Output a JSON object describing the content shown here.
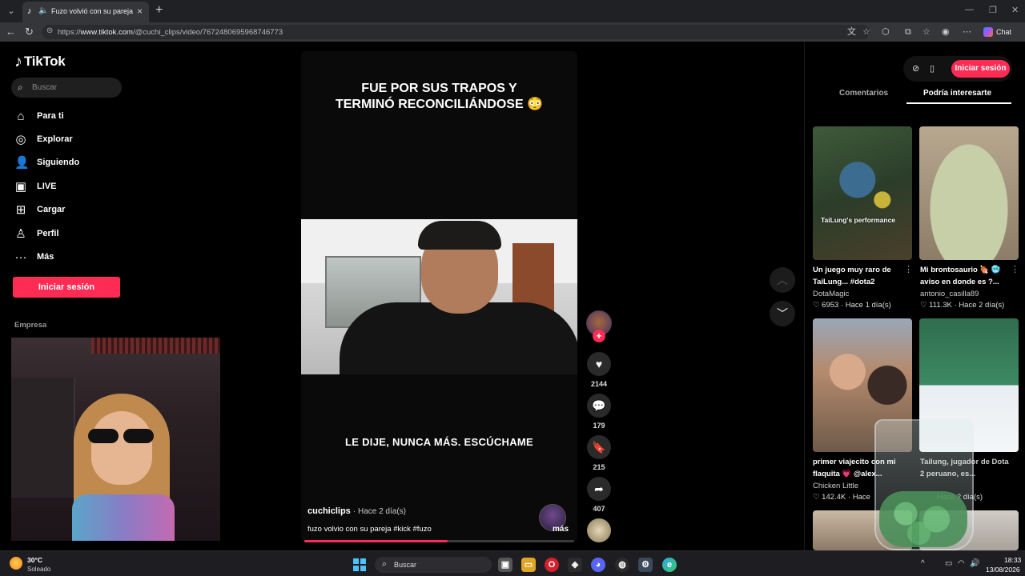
{
  "browser": {
    "tab_title": "Fuzo volvió con su pareja: qu",
    "url_prefix": "https://",
    "url_host": "www.tiktok.com",
    "url_path": "/@cuchi_clips/video/7672480695968746773",
    "chat_label": "Chat"
  },
  "sidebar": {
    "logo": "TikTok",
    "search_placeholder": "Buscar",
    "items": [
      {
        "label": "Para ti",
        "icon": "home-icon"
      },
      {
        "label": "Explorar",
        "icon": "compass-icon"
      },
      {
        "label": "Siguiendo",
        "icon": "following-icon"
      },
      {
        "label": "LIVE",
        "icon": "live-icon"
      },
      {
        "label": "Cargar",
        "icon": "upload-icon"
      },
      {
        "label": "Perfil",
        "icon": "profile-icon"
      },
      {
        "label": "Más",
        "icon": "more-icon"
      }
    ],
    "login_label": "Iniciar sesión",
    "section_label": "Empresa"
  },
  "video": {
    "caption_top": "FUE POR SUS TRAPOS Y TERMINÓ RECONCILIÁNDOSE 😳",
    "caption_bottom": "LE DIJE, NUNCA MÁS. ESCÚCHAME",
    "author": "cuchiclips",
    "time": "· Hace 2 día(s)",
    "description": "fuzo volvio con su pareja #kick #fuzo",
    "more_label": "más",
    "progress_percent": 53
  },
  "actions": {
    "likes": "2144",
    "comments": "179",
    "saves": "215",
    "shares": "407"
  },
  "right_panel": {
    "login_label": "Iniciar sesión",
    "tab_comments": "Comentarios",
    "tab_suggested": "Podría interesarte",
    "cards": [
      {
        "title": "Un juego muy raro de TaiLung... #dota2",
        "author": "DotaMagic",
        "likes": "6953",
        "time": "Hace 1 día(s)",
        "overlay": "TaiLung's performance"
      },
      {
        "title": "Mi brontosaurio 🍖 🥶 aviso en donde es ?...",
        "author": "antonio_casilla89",
        "likes": "111.3K",
        "time": "Hace 2 día(s)",
        "overlay": ""
      },
      {
        "title": "primer viajecito con mi flaquita 💗 @alex...",
        "author": "Chicken Little",
        "likes": "142.4K",
        "time": "Hace",
        "overlay": ""
      },
      {
        "title": "Tailung, jugador de Dota 2 peruano, es...",
        "author": "",
        "likes": "",
        "time": "Hace 2 día(s)",
        "overlay": ""
      }
    ]
  },
  "taskbar": {
    "temperature": "30°C",
    "condition": "Soleado",
    "search_placeholder": "Buscar",
    "time": "18:33",
    "date": "13/08/2026"
  }
}
